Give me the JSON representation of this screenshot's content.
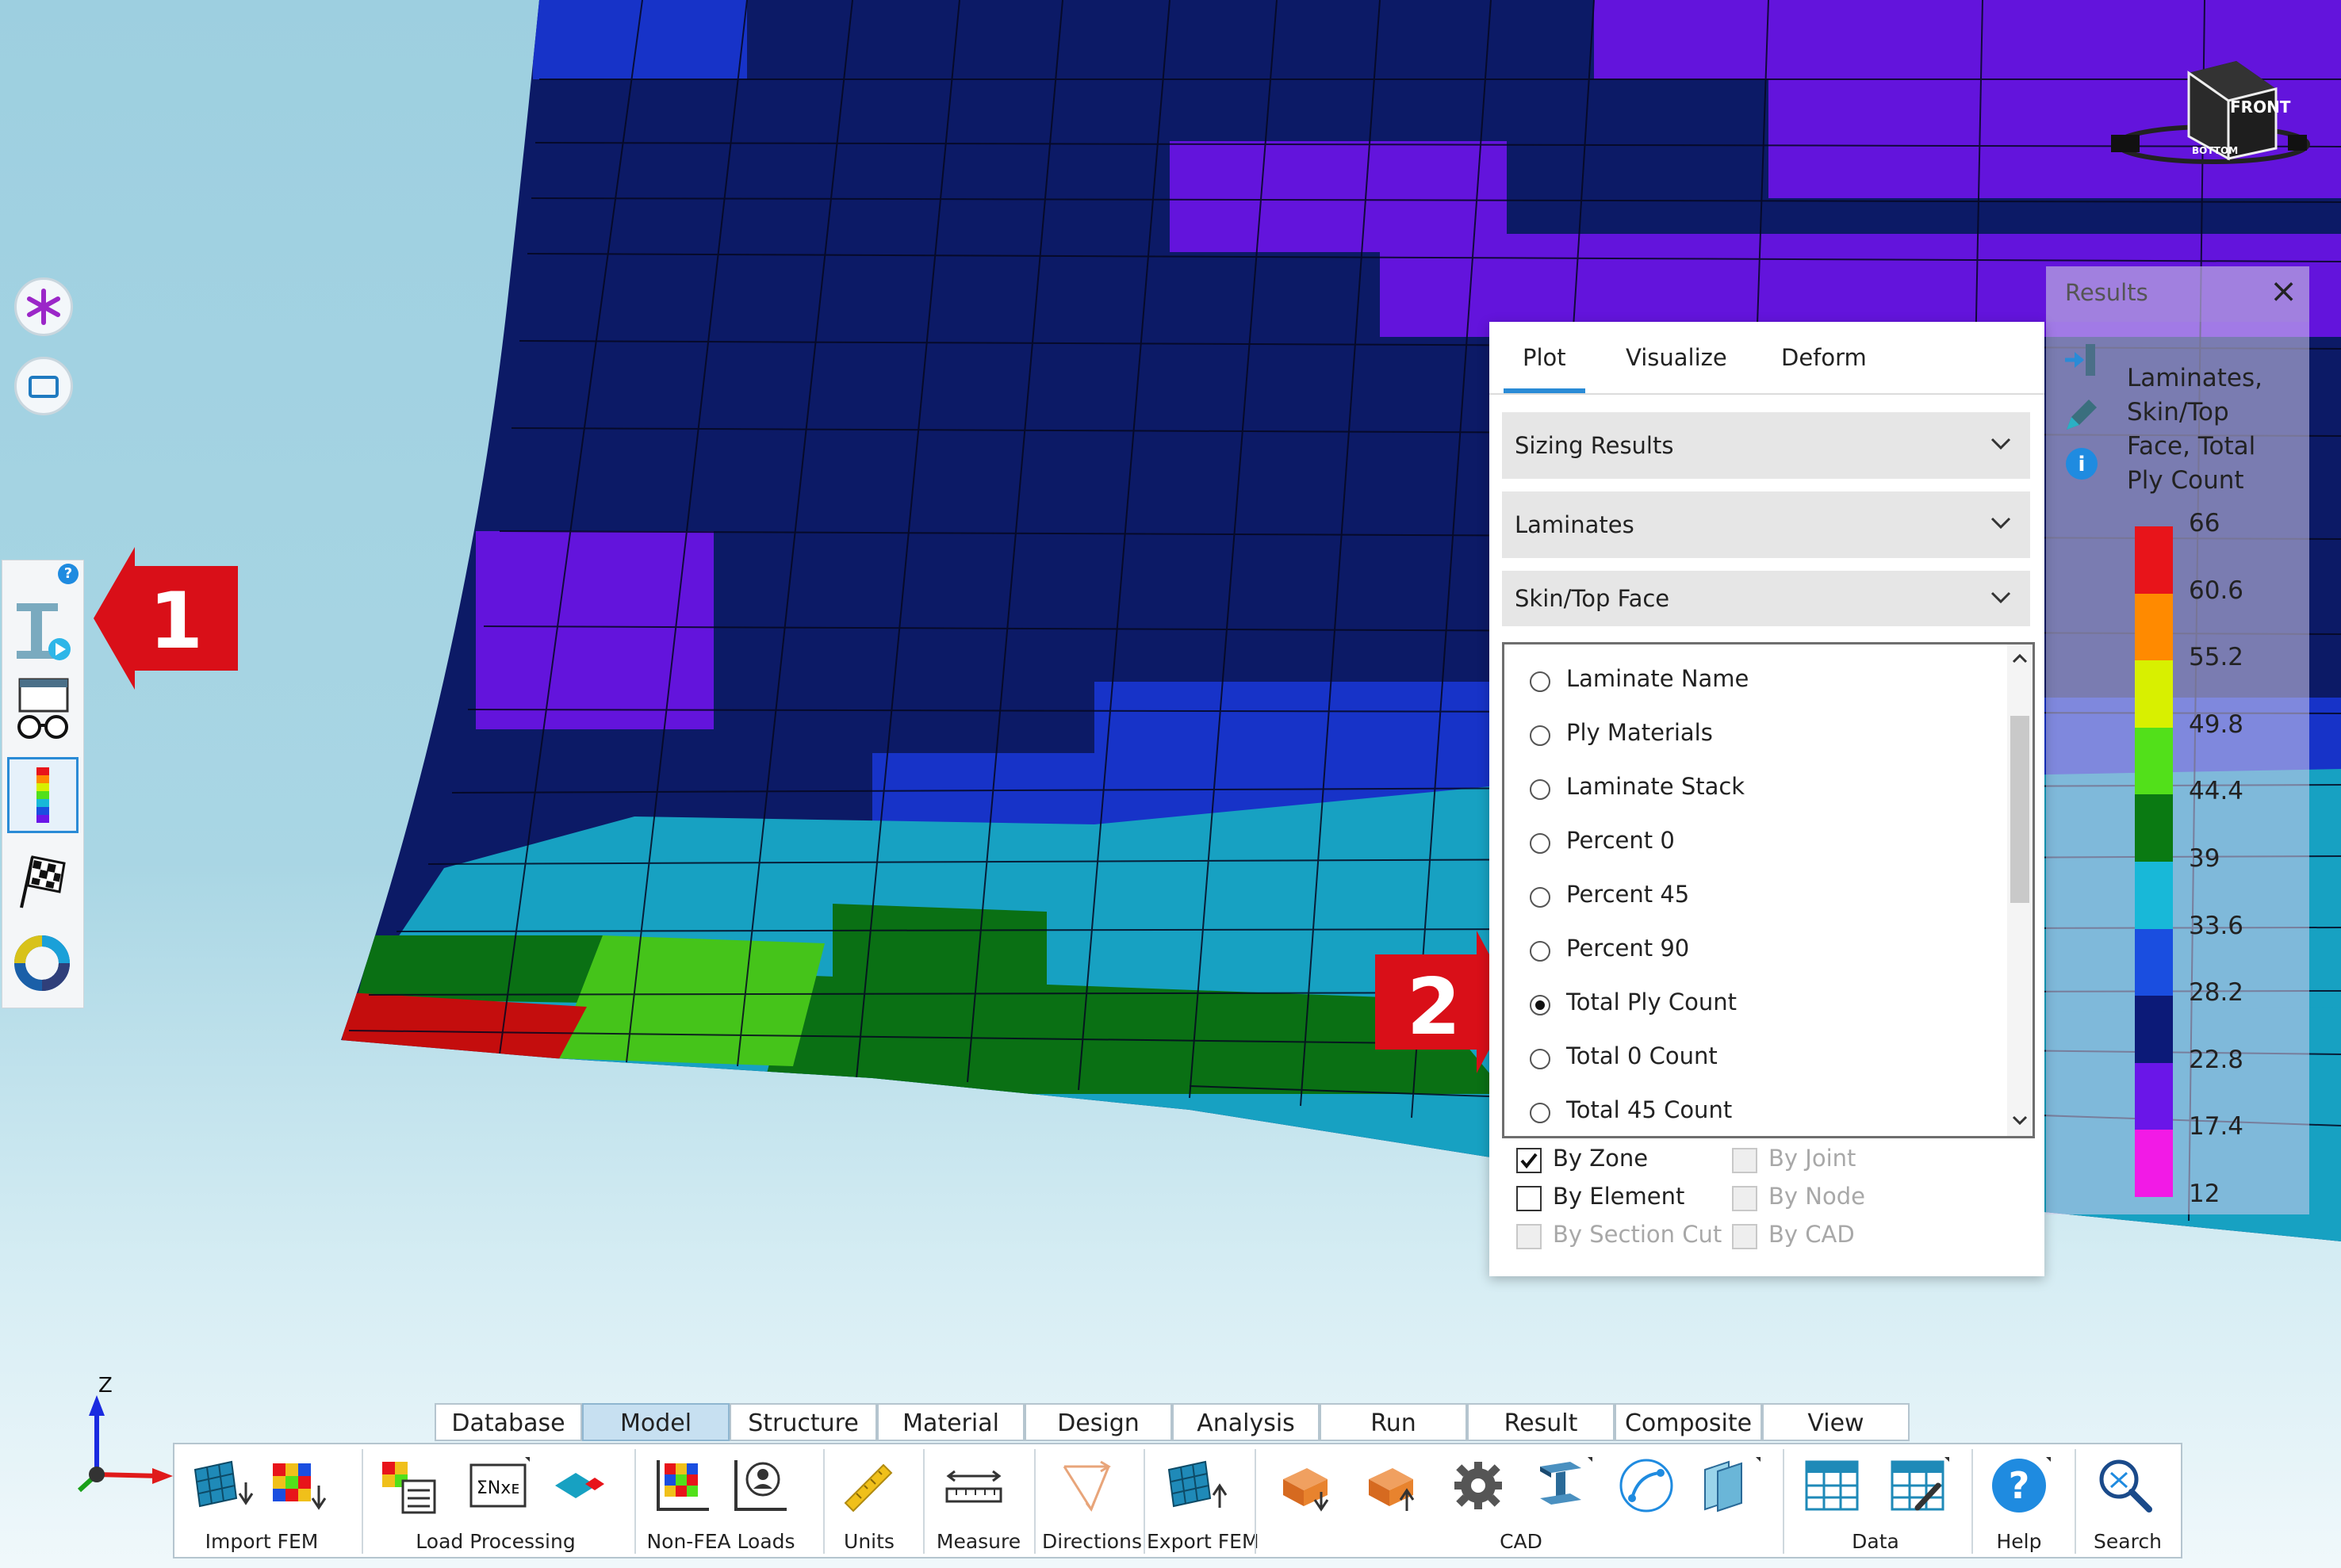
{
  "left_toolbar": {
    "buttons": [
      {
        "icon": "asterisk-icon"
      },
      {
        "icon": "rectangle-icon"
      }
    ],
    "panel_help": "?",
    "panel_icons": [
      "properties-icon",
      "visualize-glasses-icon",
      "color-scale-icon",
      "checkered-flag-icon",
      "donut-chart-icon"
    ]
  },
  "callouts": [
    "1",
    "2"
  ],
  "results_panel": {
    "tabs": [
      "Plot",
      "Visualize",
      "Deform"
    ],
    "active_tab": "Plot",
    "dropdowns": [
      "Sizing Results",
      "Laminates",
      "Skin/Top Face"
    ],
    "radio_options": [
      "Laminate Name",
      "Ply Materials",
      "Laminate Stack",
      "Percent 0",
      "Percent 45",
      "Percent 90",
      "Total Ply Count",
      "Total 0 Count",
      "Total 45 Count"
    ],
    "selected_option": "Total Ply Count",
    "checkboxes": [
      {
        "label": "By Zone",
        "checked": true,
        "enabled": true
      },
      {
        "label": "By Joint",
        "checked": false,
        "enabled": false
      },
      {
        "label": "By Element",
        "checked": false,
        "enabled": true
      },
      {
        "label": "By Node",
        "checked": false,
        "enabled": false
      },
      {
        "label": "By Section Cut",
        "checked": false,
        "enabled": false
      },
      {
        "label": "By CAD",
        "checked": false,
        "enabled": false
      }
    ]
  },
  "legend": {
    "title": "Results",
    "close": "×",
    "description_lines": [
      "Laminates,",
      "Skin/Top",
      "Face, Total",
      "Ply Count"
    ],
    "values": [
      "66",
      "60.6",
      "55.2",
      "49.8",
      "44.4",
      "39",
      "33.6",
      "28.2",
      "22.8",
      "17.4",
      "12"
    ],
    "colors": [
      "#e8141a",
      "#ff8a00",
      "#d8f000",
      "#52e01a",
      "#0a7a12",
      "#18b8d8",
      "#1a4ee0",
      "#0c1a78",
      "#6a16e8",
      "#f21ae6"
    ]
  },
  "nav_cube": {
    "faces": [
      "FRONT",
      "BOTTOM"
    ]
  },
  "triad": {
    "z_label": "Z"
  },
  "ribbon": {
    "tabs": [
      "Database",
      "Model",
      "Structure",
      "Material",
      "Design",
      "Analysis",
      "Run",
      "Result",
      "Composite",
      "View"
    ],
    "active_tab": "Model",
    "groups": [
      "Import FEM",
      "Load Processing",
      "Non-FEA Loads",
      "Units",
      "Measure",
      "Directions",
      "Export FEM",
      "CAD",
      "Data",
      "Help",
      "Search"
    ]
  }
}
